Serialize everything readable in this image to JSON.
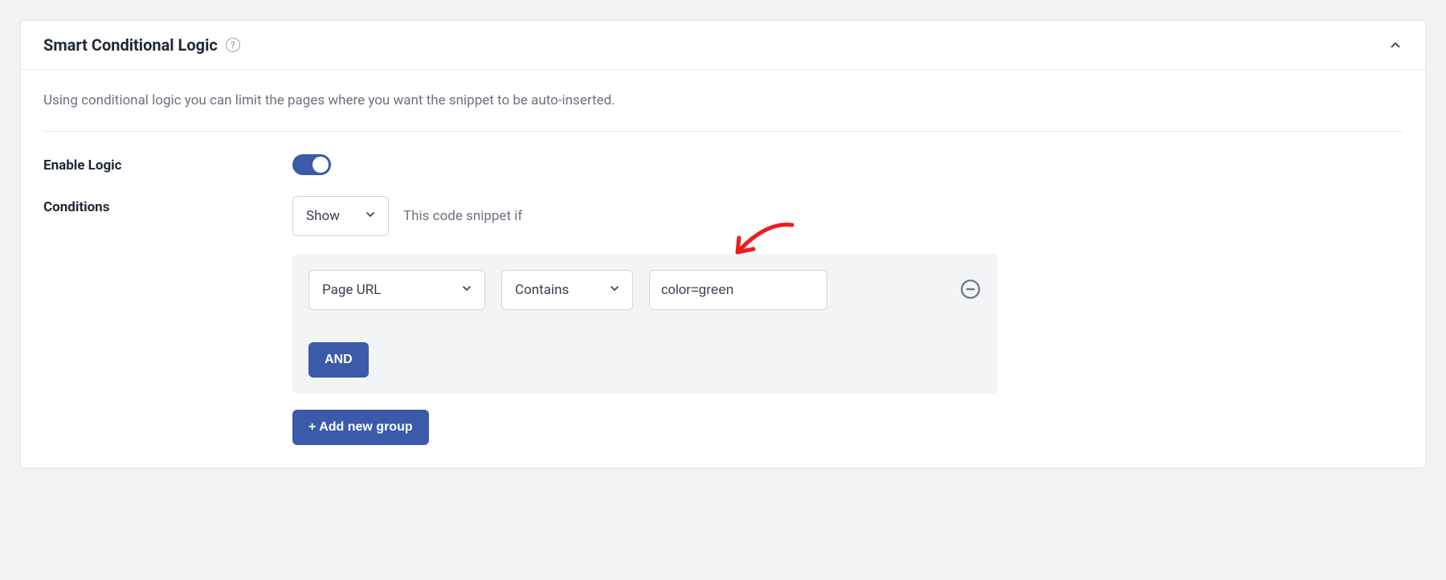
{
  "panel": {
    "title": "Smart Conditional Logic",
    "description": "Using conditional logic you can limit the pages where you want the snippet to be auto-inserted."
  },
  "enable": {
    "label": "Enable Logic",
    "value": true
  },
  "conditions": {
    "label": "Conditions",
    "action": "Show",
    "hint": "This code snippet if",
    "field": "Page URL",
    "operator": "Contains",
    "value": "color=green",
    "and_label": "AND",
    "add_group_label": "+ Add new group"
  }
}
